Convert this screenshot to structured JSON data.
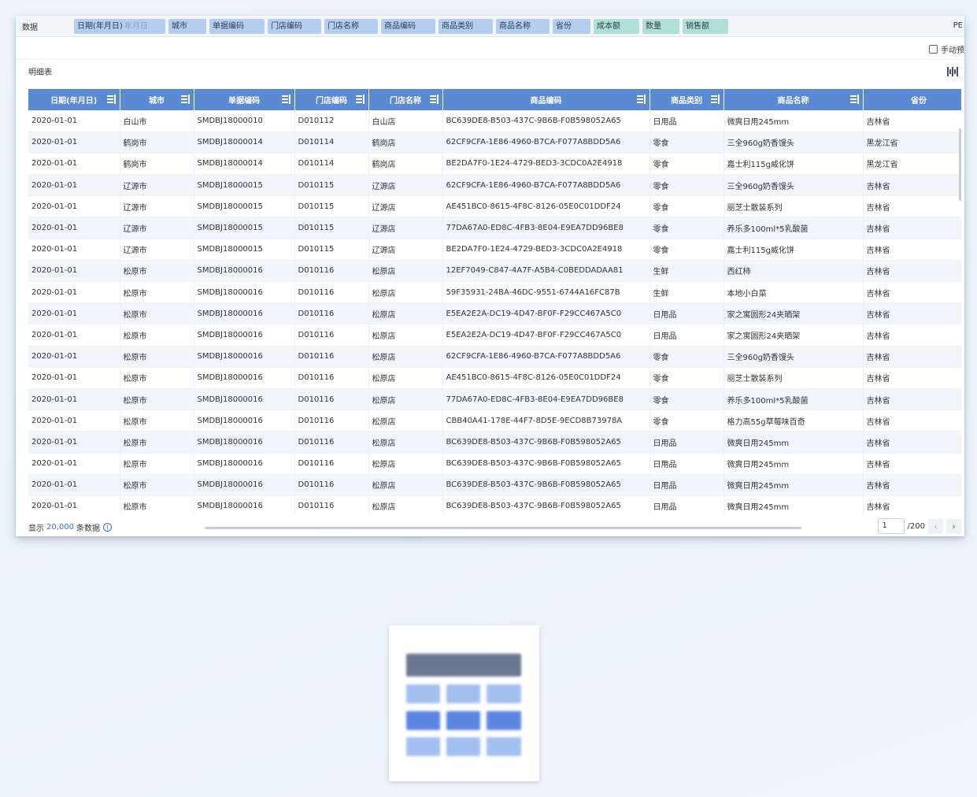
{
  "field_bar": {
    "label": "数据",
    "dimensions": [
      {
        "name": "日期(年月日)",
        "sub": "年月日"
      },
      {
        "name": "城市"
      },
      {
        "name": "单据编码"
      },
      {
        "name": "门店编码"
      },
      {
        "name": "门店名称"
      },
      {
        "name": "商品编码"
      },
      {
        "name": "商品类别"
      },
      {
        "name": "商品名称"
      },
      {
        "name": "省份"
      }
    ],
    "measures": [
      "成本额",
      "数量",
      "销售额"
    ],
    "right_cut": "PE"
  },
  "manual_preview_label": "手动预",
  "table_title": "明细表",
  "columns": [
    "日期(年月日)",
    "城市",
    "单据编码",
    "门店编码",
    "门店名称",
    "商品编码",
    "商品类别",
    "商品名称",
    "省份"
  ],
  "rows": [
    [
      "2020-01-01",
      "白山市",
      "SMDBJ18000010",
      "D010112",
      "白山店",
      "BC639DE8-B503-437C-9B6B-F0B598052A65",
      "日用品",
      "微爽日用245mm",
      "吉林省"
    ],
    [
      "2020-01-01",
      "鹤岗市",
      "SMDBJ18000014",
      "D010114",
      "鹤岗店",
      "62CF9CFA-1E86-4960-B7CA-F077A8BDD5A6",
      "零食",
      "三全960g奶香馒头",
      "黑龙江省"
    ],
    [
      "2020-01-01",
      "鹤岗市",
      "SMDBJ18000014",
      "D010114",
      "鹤岗店",
      "BE2DA7F0-1E24-4729-BED3-3CDC0A2E4918",
      "零食",
      "嘉士利115g威化饼",
      "黑龙江省"
    ],
    [
      "2020-01-01",
      "辽源市",
      "SMDBJ18000015",
      "D010115",
      "辽源店",
      "62CF9CFA-1E86-4960-B7CA-F077A8BDD5A6",
      "零食",
      "三全960g奶香馒头",
      "吉林省"
    ],
    [
      "2020-01-01",
      "辽源市",
      "SMDBJ18000015",
      "D010115",
      "辽源店",
      "AE451BC0-8615-4F8C-8126-05E0C01DDF24",
      "零食",
      "丽芝士散装系列",
      "吉林省"
    ],
    [
      "2020-01-01",
      "辽源市",
      "SMDBJ18000015",
      "D010115",
      "辽源店",
      "77DA67A0-ED8C-4FB3-8E04-E9EA7DD96BE8",
      "零食",
      "养乐多100ml*5乳酸菌",
      "吉林省"
    ],
    [
      "2020-01-01",
      "辽源市",
      "SMDBJ18000015",
      "D010115",
      "辽源店",
      "BE2DA7F0-1E24-4729-BED3-3CDC0A2E4918",
      "零食",
      "嘉士利115g威化饼",
      "吉林省"
    ],
    [
      "2020-01-01",
      "松原市",
      "SMDBJ18000016",
      "D010116",
      "松原店",
      "12EF7049-C847-4A7F-A5B4-C0BEDDADAA81",
      "生鲜",
      "西红柿",
      "吉林省"
    ],
    [
      "2020-01-01",
      "松原市",
      "SMDBJ18000016",
      "D010116",
      "松原店",
      "59F35931-24BA-46DC-9551-6744A16FC87B",
      "生鲜",
      "本地小白菜",
      "吉林省"
    ],
    [
      "2020-01-01",
      "松原市",
      "SMDBJ18000016",
      "D010116",
      "松原店",
      "E5EA2E2A-DC19-4D47-BF0F-F29CC467A5C0",
      "日用品",
      "家之寓圆形24夹晒架",
      "吉林省"
    ],
    [
      "2020-01-01",
      "松原市",
      "SMDBJ18000016",
      "D010116",
      "松原店",
      "E5EA2E2A-DC19-4D47-BF0F-F29CC467A5C0",
      "日用品",
      "家之寓圆形24夹晒架",
      "吉林省"
    ],
    [
      "2020-01-01",
      "松原市",
      "SMDBJ18000016",
      "D010116",
      "松原店",
      "62CF9CFA-1E86-4960-B7CA-F077A8BDD5A6",
      "零食",
      "三全960g奶香馒头",
      "吉林省"
    ],
    [
      "2020-01-01",
      "松原市",
      "SMDBJ18000016",
      "D010116",
      "松原店",
      "AE451BC0-8615-4F8C-8126-05E0C01DDF24",
      "零食",
      "丽芝士散装系列",
      "吉林省"
    ],
    [
      "2020-01-01",
      "松原市",
      "SMDBJ18000016",
      "D010116",
      "松原店",
      "77DA67A0-ED8C-4FB3-8E04-E9EA7DD96BE8",
      "零食",
      "养乐多100ml*5乳酸菌",
      "吉林省"
    ],
    [
      "2020-01-01",
      "松原市",
      "SMDBJ18000016",
      "D010116",
      "松原店",
      "CBB40A41-178E-44F7-8D5E-9ECD8B73978A",
      "零食",
      "格力高55g草莓味百奇",
      "吉林省"
    ],
    [
      "2020-01-01",
      "松原市",
      "SMDBJ18000016",
      "D010116",
      "松原店",
      "BC639DE8-B503-437C-9B6B-F0B598052A65",
      "日用品",
      "微爽日用245mm",
      "吉林省"
    ],
    [
      "2020-01-01",
      "松原市",
      "SMDBJ18000016",
      "D010116",
      "松原店",
      "BC639DE8-B503-437C-9B6B-F0B598052A65",
      "日用品",
      "微爽日用245mm",
      "吉林省"
    ],
    [
      "2020-01-01",
      "松原市",
      "SMDBJ18000016",
      "D010116",
      "松原店",
      "BC639DE8-B503-437C-9B6B-F0B598052A65",
      "日用品",
      "微爽日用245mm",
      "吉林省"
    ],
    [
      "2020-01-01",
      "松原市",
      "SMDBJ18000016",
      "D010116",
      "松原店",
      "BC639DE8-B503-437C-9B6B-F0B598052A65",
      "日用品",
      "微爽日用245mm",
      "吉林省"
    ]
  ],
  "footer": {
    "prefix": "显示",
    "count": "20,000",
    "suffix": "条数据",
    "info_icon": "i"
  },
  "pager": {
    "current": "1",
    "total": "/200",
    "prev_icon": "‹",
    "next_icon": "›"
  },
  "colors": {
    "header": "#5a8ad3",
    "dimension_chip": "#b5cdee",
    "measure_chip": "#aee0d6",
    "link": "#3a74c9"
  }
}
